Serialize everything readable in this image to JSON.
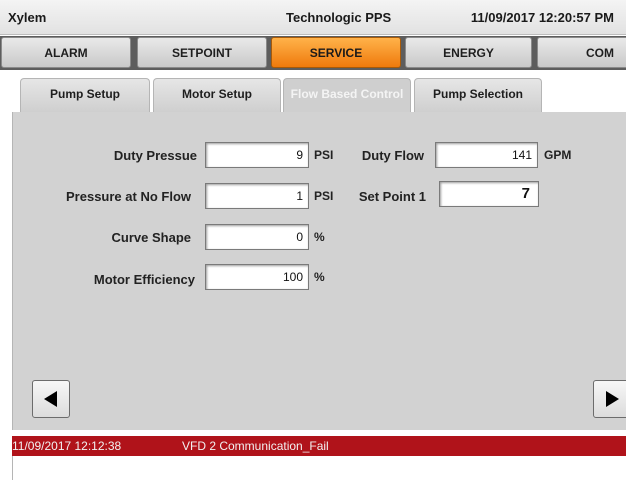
{
  "title_bar": {
    "app_name": "Xylem",
    "mode": "Technologic PPS",
    "datetime": "11/09/2017 12:20:57 PM"
  },
  "main_tabs": [
    {
      "label": "ALARM",
      "active": false
    },
    {
      "label": "SETPOINT",
      "active": false
    },
    {
      "label": "SERVICE",
      "active": true
    },
    {
      "label": "ENERGY",
      "active": false
    },
    {
      "label": "COM",
      "active": false
    }
  ],
  "sub_tabs": [
    {
      "label": "Pump Setup",
      "active": false
    },
    {
      "label": "Motor Setup",
      "active": false
    },
    {
      "label": "Flow Based Control",
      "active": true
    },
    {
      "label": "Pump Selection",
      "active": false
    }
  ],
  "form": {
    "duty_pressure": {
      "label": "Duty Pressue",
      "value": "9",
      "unit": "PSI"
    },
    "pressure_no_flow": {
      "label": "Pressure at No Flow",
      "value": "1",
      "unit": "PSI"
    },
    "curve_shape": {
      "label": "Curve Shape",
      "value": "0",
      "unit": "%"
    },
    "motor_efficiency": {
      "label": "Motor Efficiency",
      "value": "100",
      "unit": "%"
    },
    "duty_flow": {
      "label": "Duty Flow",
      "value": "141",
      "unit": "GPM"
    },
    "set_point_1": {
      "label": "Set Point 1",
      "value": "7"
    }
  },
  "alarm": {
    "timestamp": "11/09/2017 12:12:38",
    "message": "VFD 2 Communication_Fail"
  },
  "colors": {
    "active_tab": "#ef7a0c",
    "alarm_bar": "#b0131a",
    "panel": "#d2d2d2"
  },
  "icons": {
    "prev": "triangle-left-icon",
    "next": "triangle-right-icon"
  }
}
